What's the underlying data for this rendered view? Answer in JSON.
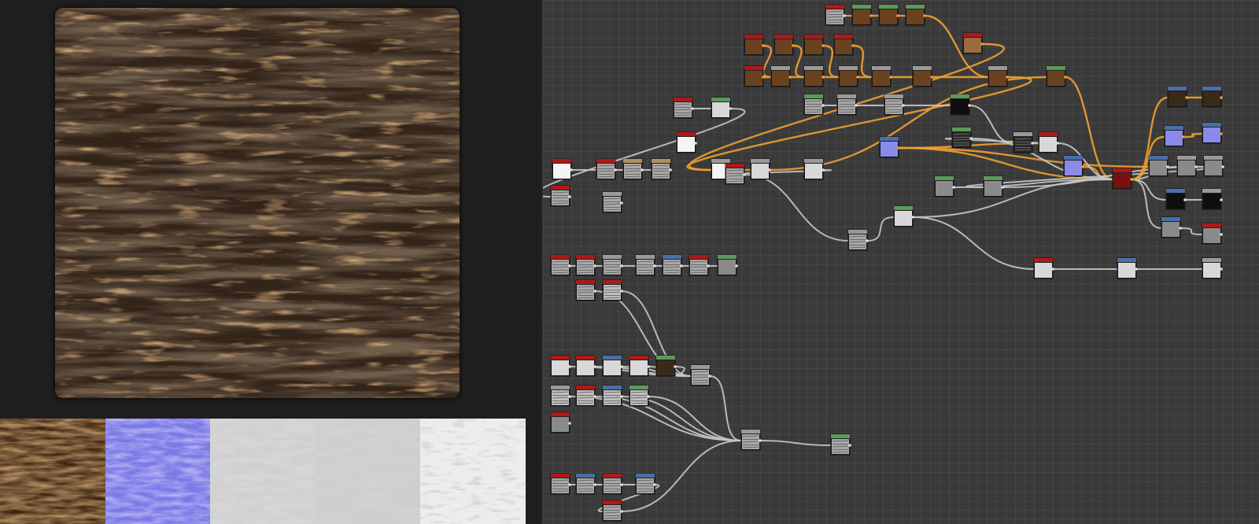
{
  "title": "",
  "colors": {
    "app_background": "#1e1e1e",
    "graph_background": "#3a3a3a",
    "wire_grayscale": "#c8c8c8",
    "wire_color": "#f0a030",
    "header_red": "#b01818",
    "header_blue": "#4a6fa8",
    "header_green": "#5a9a5a",
    "header_gray": "#9a9a9a",
    "header_tan": "#b09060"
  },
  "viewport": {
    "preview_icon": "bark-material-preview",
    "output_maps": [
      {
        "name": "basecolor",
        "icon": "basecolor-map"
      },
      {
        "name": "normal",
        "icon": "normal-map"
      },
      {
        "name": "height",
        "icon": "height-map"
      },
      {
        "name": "roughness",
        "icon": "roughness-map"
      },
      {
        "name": "ambient-occlusion",
        "icon": "ao-map"
      }
    ]
  },
  "graph": {
    "nodes": [
      {
        "id": "n1",
        "header": "red",
        "thumb": "noise",
        "output": "gray"
      },
      {
        "id": "n2",
        "header": "green",
        "thumb": "brown",
        "output": "color"
      },
      {
        "id": "n3",
        "header": "green",
        "thumb": "brown",
        "output": "color"
      },
      {
        "id": "n4",
        "header": "green",
        "thumb": "brown",
        "output": "color"
      },
      {
        "id": "n5",
        "header": "red",
        "thumb": "brown",
        "output": "color"
      },
      {
        "id": "n6",
        "header": "red",
        "thumb": "brown",
        "output": "color"
      },
      {
        "id": "n7",
        "header": "red",
        "thumb": "brown",
        "output": "color"
      },
      {
        "id": "n8",
        "header": "red",
        "thumb": "brown",
        "output": "color"
      },
      {
        "id": "n9",
        "header": "red",
        "thumb": "tan",
        "output": "color"
      },
      {
        "id": "n10",
        "header": "red",
        "thumb": "brown",
        "output": "color"
      },
      {
        "id": "n11",
        "header": "gray",
        "thumb": "brown",
        "output": "color"
      },
      {
        "id": "n12",
        "header": "gray",
        "thumb": "brown",
        "output": "color"
      },
      {
        "id": "n13",
        "header": "gray",
        "thumb": "brown",
        "output": "color"
      },
      {
        "id": "n14",
        "header": "gray",
        "thumb": "brown",
        "output": "color"
      },
      {
        "id": "n15",
        "header": "gray",
        "thumb": "brown",
        "output": "color"
      },
      {
        "id": "n16",
        "header": "gray",
        "thumb": "brown",
        "output": "color"
      },
      {
        "id": "n17",
        "header": "green",
        "thumb": "brown",
        "output": "color"
      },
      {
        "id": "n18",
        "header": "red",
        "thumb": "noise",
        "output": "gray"
      },
      {
        "id": "n19",
        "header": "green",
        "thumb": "light",
        "output": "gray"
      },
      {
        "id": "n20",
        "header": "green",
        "thumb": "noise",
        "output": "gray"
      },
      {
        "id": "n21",
        "header": "gray",
        "thumb": "noise",
        "output": "gray"
      },
      {
        "id": "n22",
        "header": "gray",
        "thumb": "noise",
        "output": "gray"
      },
      {
        "id": "n23",
        "header": "green",
        "thumb": "black",
        "output": "gray"
      },
      {
        "id": "n24",
        "header": "red",
        "thumb": "white",
        "output": "gray"
      },
      {
        "id": "n25",
        "header": "blue",
        "thumb": "normal",
        "output": "color"
      },
      {
        "id": "n26",
        "header": "blue",
        "thumb": "dark",
        "output": "color"
      },
      {
        "id": "n27",
        "header": "blue",
        "thumb": "dark",
        "output": "color"
      },
      {
        "id": "n28",
        "header": "blue",
        "thumb": "normal",
        "output": "color"
      },
      {
        "id": "n29",
        "header": "blue",
        "thumb": "normal",
        "output": "color"
      },
      {
        "id": "n30",
        "header": "green",
        "thumb": "speckle",
        "output": "gray"
      },
      {
        "id": "n31",
        "header": "gray",
        "thumb": "speckle",
        "output": "gray"
      },
      {
        "id": "n32",
        "header": "red",
        "thumb": "light",
        "output": "gray"
      },
      {
        "id": "n33",
        "header": "blue",
        "thumb": "normal",
        "output": "color"
      },
      {
        "id": "n34",
        "header": "red",
        "thumb": "red",
        "output": "color"
      },
      {
        "id": "n35",
        "header": "blue",
        "thumb": "gray",
        "output": "gray"
      },
      {
        "id": "n36",
        "header": "green",
        "thumb": "gray",
        "output": "gray"
      },
      {
        "id": "n37",
        "header": "gray",
        "thumb": "gray",
        "output": "gray"
      },
      {
        "id": "n38",
        "header": "blue",
        "thumb": "black",
        "output": "gray"
      },
      {
        "id": "n39",
        "header": "gray",
        "thumb": "black",
        "output": "gray"
      },
      {
        "id": "n40",
        "header": "blue",
        "thumb": "gray",
        "output": "gray"
      },
      {
        "id": "n41",
        "header": "gray",
        "thumb": "gray",
        "output": "gray"
      },
      {
        "id": "n42",
        "header": "red",
        "thumb": "gray",
        "output": "gray"
      },
      {
        "id": "n43",
        "header": "green",
        "thumb": "gray",
        "output": "gray"
      },
      {
        "id": "n44",
        "header": "green",
        "thumb": "light",
        "output": "gray"
      },
      {
        "id": "n45",
        "header": "gray",
        "thumb": "noise",
        "output": "gray"
      },
      {
        "id": "n46",
        "header": "red",
        "thumb": "light",
        "output": "gray"
      },
      {
        "id": "n47",
        "header": "blue",
        "thumb": "light",
        "output": "gray"
      },
      {
        "id": "n48",
        "header": "gray",
        "thumb": "light",
        "output": "gray"
      },
      {
        "id": "n49",
        "header": "red",
        "thumb": "white",
        "output": "gray"
      },
      {
        "id": "n50",
        "header": "red",
        "thumb": "noise",
        "output": "gray"
      },
      {
        "id": "n51",
        "header": "gray",
        "thumb": "noise",
        "output": "gray"
      },
      {
        "id": "n52",
        "header": "red",
        "thumb": "noise",
        "output": "gray"
      },
      {
        "id": "n53",
        "header": "tan",
        "thumb": "noise",
        "output": "gray"
      },
      {
        "id": "n54",
        "header": "tan",
        "thumb": "noise",
        "output": "gray"
      },
      {
        "id": "n55",
        "header": "gray",
        "thumb": "white",
        "output": "gray"
      },
      {
        "id": "n56",
        "header": "gray",
        "thumb": "light",
        "output": "gray"
      },
      {
        "id": "n57",
        "header": "gray",
        "thumb": "light",
        "output": "gray"
      },
      {
        "id": "n58",
        "header": "red",
        "thumb": "noise",
        "output": "gray"
      },
      {
        "id": "n59",
        "header": "red",
        "thumb": "gray",
        "output": "gray"
      },
      {
        "id": "n60",
        "header": "gray",
        "thumb": "noise",
        "output": "gray"
      },
      {
        "id": "n61",
        "header": "red",
        "thumb": "noise",
        "output": "gray"
      },
      {
        "id": "n62",
        "header": "red",
        "thumb": "noise",
        "output": "gray"
      },
      {
        "id": "n63",
        "header": "gray",
        "thumb": "noise",
        "output": "gray"
      },
      {
        "id": "n64",
        "header": "gray",
        "thumb": "noise",
        "output": "gray"
      },
      {
        "id": "n65",
        "header": "blue",
        "thumb": "noise",
        "output": "gray"
      },
      {
        "id": "n66",
        "header": "red",
        "thumb": "noise",
        "output": "gray"
      },
      {
        "id": "n67",
        "header": "green",
        "thumb": "gray",
        "output": "gray"
      },
      {
        "id": "n68",
        "header": "red",
        "thumb": "noise",
        "output": "gray"
      },
      {
        "id": "n69",
        "header": "red",
        "thumb": "stripes",
        "output": "gray"
      },
      {
        "id": "n70",
        "header": "red",
        "thumb": "light",
        "output": "gray"
      },
      {
        "id": "n71",
        "header": "red",
        "thumb": "light",
        "output": "gray"
      },
      {
        "id": "n72",
        "header": "blue",
        "thumb": "light",
        "output": "gray"
      },
      {
        "id": "n73",
        "header": "red",
        "thumb": "light",
        "output": "gray"
      },
      {
        "id": "n74",
        "header": "green",
        "thumb": "dark",
        "output": "gray"
      },
      {
        "id": "n75",
        "header": "gray",
        "thumb": "noise",
        "output": "gray"
      },
      {
        "id": "n76",
        "header": "gray",
        "thumb": "stripes",
        "output": "gray"
      },
      {
        "id": "n77",
        "header": "red",
        "thumb": "stripes",
        "output": "gray"
      },
      {
        "id": "n78",
        "header": "blue",
        "thumb": "stripes",
        "output": "gray"
      },
      {
        "id": "n79",
        "header": "green",
        "thumb": "stripes",
        "output": "gray"
      },
      {
        "id": "n80",
        "header": "red",
        "thumb": "gray",
        "output": "gray"
      },
      {
        "id": "n81",
        "header": "gray",
        "thumb": "noise",
        "output": "gray"
      },
      {
        "id": "n82",
        "header": "green",
        "thumb": "noise",
        "output": "gray"
      },
      {
        "id": "n83",
        "header": "red",
        "thumb": "noise",
        "output": "gray"
      },
      {
        "id": "n84",
        "header": "blue",
        "thumb": "noise",
        "output": "gray"
      },
      {
        "id": "n85",
        "header": "red",
        "thumb": "noise",
        "output": "gray"
      },
      {
        "id": "n86",
        "header": "blue",
        "thumb": "noise",
        "output": "gray"
      },
      {
        "id": "n87",
        "header": "red",
        "thumb": "noise",
        "output": "gray"
      }
    ],
    "links": [
      [
        "n1",
        "n2",
        "color"
      ],
      [
        "n2",
        "n3",
        "color"
      ],
      [
        "n3",
        "n4",
        "color"
      ],
      [
        "n4",
        "n16",
        "color"
      ],
      [
        "n5",
        "n11",
        "color"
      ],
      [
        "n6",
        "n12",
        "color"
      ],
      [
        "n7",
        "n13",
        "color"
      ],
      [
        "n8",
        "n14",
        "color"
      ],
      [
        "n10",
        "n11",
        "color"
      ],
      [
        "n11",
        "n12",
        "color"
      ],
      [
        "n12",
        "n13",
        "color"
      ],
      [
        "n13",
        "n14",
        "color"
      ],
      [
        "n14",
        "n15",
        "color"
      ],
      [
        "n15",
        "n16",
        "color"
      ],
      [
        "n16",
        "n55",
        "color"
      ],
      [
        "n9",
        "n55",
        "color"
      ],
      [
        "n55",
        "n56",
        "color"
      ],
      [
        "n56",
        "n17",
        "color"
      ],
      [
        "n17",
        "n34",
        "color"
      ],
      [
        "n18",
        "n19",
        "gray"
      ],
      [
        "n19",
        "n50",
        "gray"
      ],
      [
        "n20",
        "n21",
        "gray"
      ],
      [
        "n21",
        "n22",
        "gray"
      ],
      [
        "n22",
        "n23",
        "gray"
      ],
      [
        "n23",
        "n31",
        "gray"
      ],
      [
        "n33",
        "n34",
        "color"
      ],
      [
        "n25",
        "n34",
        "color"
      ],
      [
        "n25",
        "n32",
        "color"
      ],
      [
        "n25",
        "n35",
        "color"
      ],
      [
        "n32",
        "n34",
        "gray"
      ],
      [
        "n31",
        "n30",
        "gray"
      ],
      [
        "n30",
        "n34",
        "gray"
      ],
      [
        "n36",
        "n34",
        "gray"
      ],
      [
        "n44",
        "n34",
        "gray"
      ],
      [
        "n44",
        "n46",
        "gray"
      ],
      [
        "n46",
        "n47",
        "gray"
      ],
      [
        "n47",
        "n48",
        "gray"
      ],
      [
        "n34",
        "n37",
        "gray"
      ],
      [
        "n37",
        "n43",
        "gray"
      ],
      [
        "n43",
        "n41",
        "gray"
      ],
      [
        "n34",
        "n38",
        "gray"
      ],
      [
        "n38",
        "n39",
        "gray"
      ],
      [
        "n34",
        "n40",
        "gray"
      ],
      [
        "n40",
        "n42",
        "gray"
      ],
      [
        "n34",
        "n26",
        "color"
      ],
      [
        "n26",
        "n27",
        "color"
      ],
      [
        "n34",
        "n28",
        "color"
      ],
      [
        "n28",
        "n29",
        "color"
      ],
      [
        "n49",
        "n53",
        "gray"
      ],
      [
        "n52",
        "n53",
        "gray"
      ],
      [
        "n53",
        "n54",
        "gray"
      ],
      [
        "n54",
        "n60",
        "gray"
      ],
      [
        "n60",
        "n57",
        "gray"
      ],
      [
        "n57",
        "n58",
        "gray"
      ],
      [
        "n58",
        "n45",
        "gray"
      ],
      [
        "n45",
        "n44",
        "gray"
      ],
      [
        "n61",
        "n62",
        "gray"
      ],
      [
        "n62",
        "n63",
        "gray"
      ],
      [
        "n63",
        "n64",
        "gray"
      ],
      [
        "n64",
        "n65",
        "gray"
      ],
      [
        "n65",
        "n66",
        "gray"
      ],
      [
        "n66",
        "n67",
        "gray"
      ],
      [
        "n68",
        "n75",
        "gray"
      ],
      [
        "n69",
        "n75",
        "gray"
      ],
      [
        "n70",
        "n75",
        "gray"
      ],
      [
        "n71",
        "n75",
        "gray"
      ],
      [
        "n72",
        "n75",
        "gray"
      ],
      [
        "n73",
        "n75",
        "gray"
      ],
      [
        "n74",
        "n75",
        "gray"
      ],
      [
        "n75",
        "n81",
        "gray"
      ],
      [
        "n76",
        "n81",
        "gray"
      ],
      [
        "n77",
        "n81",
        "gray"
      ],
      [
        "n78",
        "n81",
        "gray"
      ],
      [
        "n79",
        "n81",
        "gray"
      ],
      [
        "n81",
        "n82",
        "gray"
      ],
      [
        "n83",
        "n85",
        "gray"
      ],
      [
        "n84",
        "n85",
        "gray"
      ],
      [
        "n85",
        "n86",
        "gray"
      ],
      [
        "n86",
        "n87",
        "gray"
      ],
      [
        "n87",
        "n81",
        "gray"
      ]
    ]
  }
}
